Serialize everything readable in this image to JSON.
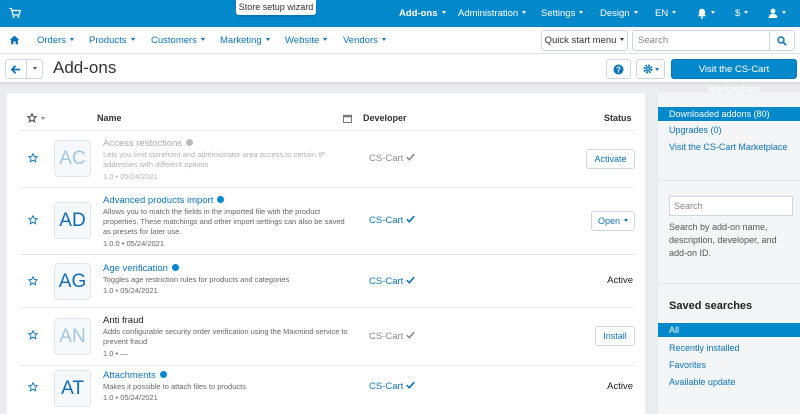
{
  "topbar": {
    "wizard": "Store setup wizard",
    "menu": [
      "Add-ons",
      "Administration",
      "Settings",
      "Design",
      "EN"
    ],
    "currency": "$",
    "icons": [
      "shopping-cart-icon",
      "bell-icon",
      "user-icon"
    ]
  },
  "nav": {
    "items": [
      "Orders",
      "Products",
      "Customers",
      "Marketing",
      "Website",
      "Vendors"
    ],
    "quick_start": "Quick start menu",
    "search_placeholder": "Search"
  },
  "page": {
    "title": "Add-ons",
    "marketplace_button": "Visit the CS-Cart Marketplace"
  },
  "table": {
    "columns": {
      "name": "Name",
      "developer": "Developer",
      "status": "Status"
    },
    "rows": [
      {
        "initials": "AC",
        "name": "Access restrictions",
        "description": "Lets you limit storefront and administrator area access to certain IP addresses with different options",
        "meta": "1.0 • 05/24/2021",
        "developer": "CS-Cart",
        "status": "Activate"
      },
      {
        "initials": "AD",
        "name": "Advanced products import",
        "description": "Allows you to match the fields in the imported file with the product properties. These matchings and other import settings can also be saved as presets for later use.",
        "meta": "1.0.0 • 05/24/2021",
        "developer": "CS-Cart",
        "status": "Open"
      },
      {
        "initials": "AG",
        "name": "Age verification",
        "description": "Toggles age restriction rules for products and categories",
        "meta": "1.0 • 05/24/2021",
        "developer": "CS-Cart",
        "status": "Active"
      },
      {
        "initials": "AN",
        "name": "Anti fraud",
        "description": "Adds configurable security order verification using the Maxmind service to prevent fraud",
        "meta": "1.0 • —",
        "developer": "CS-Cart",
        "status": "Install"
      },
      {
        "initials": "AT",
        "name": "Attachments",
        "description": "Makes it possible to attach files to products",
        "meta": "1.0 • 05/24/2021",
        "developer": "CS-Cart",
        "status": "Active"
      }
    ]
  },
  "sidebar": {
    "tabs": [
      "Downloaded addons (80)",
      "Upgrades (0)",
      "Visit the CS-Cart Marketplace"
    ],
    "filter_placeholder": "Search",
    "filter_help": "Search by add-on name, description, developer, and add-on ID.",
    "saved_title": "Saved searches",
    "saved": [
      "All",
      "Recently installed",
      "Favorites",
      "Available update"
    ]
  },
  "colors": {
    "accent": "#0388cc",
    "link": "#0d73b8"
  }
}
